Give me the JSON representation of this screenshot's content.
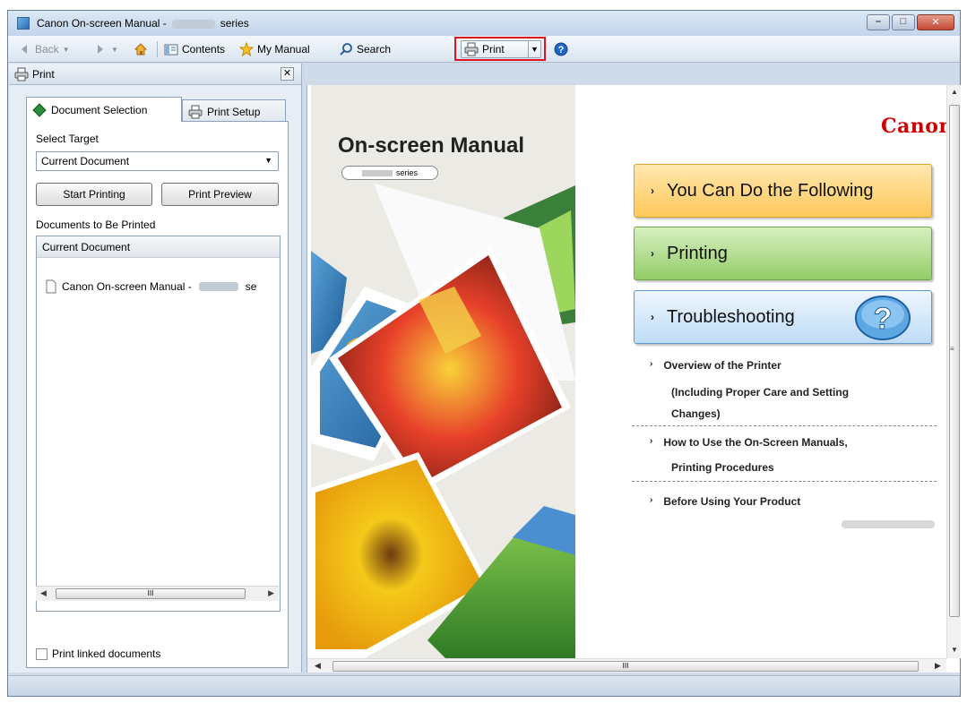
{
  "window": {
    "title_prefix": "Canon On-screen Manual -",
    "title_suffix": "series"
  },
  "toolbar": {
    "back": "Back",
    "contents": "Contents",
    "my_manual": "My Manual",
    "search": "Search",
    "print": "Print"
  },
  "left_pane": {
    "header": "Print",
    "close_glyph": "✕",
    "tabs": {
      "document_selection": "Document Selection",
      "print_setup": "Print Setup"
    },
    "select_target_label": "Select Target",
    "select_target_value": "Current Document",
    "start_printing": "Start Printing",
    "print_preview": "Print Preview",
    "documents_label": "Documents to Be Printed",
    "list_header": "Current Document",
    "list_items": [
      "Canon On-screen Manual -",
      "se"
    ],
    "scroll_grip": "III",
    "print_linked": "Print linked documents"
  },
  "content": {
    "cover_title": "On-screen Manual",
    "series_label": "series",
    "brand": "Canon",
    "big_buttons": {
      "can_do": "You Can Do the Following",
      "printing": "Printing",
      "troubleshooting": "Troubleshooting"
    },
    "links": {
      "overview_1": "Overview of the Printer",
      "overview_2": "(Including Proper Care and Setting",
      "overview_3": "Changes)",
      "howto_1": "How to Use the On-Screen Manuals,",
      "howto_2": "Printing Procedures",
      "before": "Before Using Your Product"
    },
    "scroll_grip": "III"
  },
  "colors": {
    "brand_red": "#cc0000",
    "highlight": "#e0141e"
  }
}
